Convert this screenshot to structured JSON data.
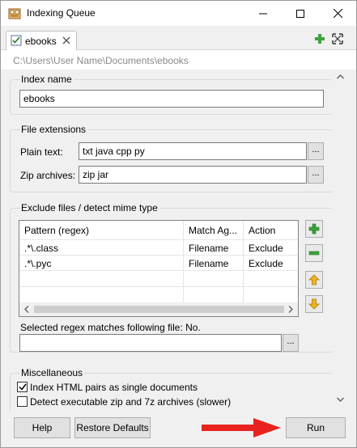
{
  "window": {
    "title": "Indexing Queue"
  },
  "tab": {
    "label": "ebooks"
  },
  "path": "C:\\Users\\User Name\\Documents\\ebooks",
  "index_name": {
    "label": "Index name",
    "value": "ebooks"
  },
  "file_extensions": {
    "label": "File extensions",
    "plain_text_label": "Plain text:",
    "plain_text_value": "txt java cpp py",
    "zip_label": "Zip archives:",
    "zip_value": "zip jar",
    "browse_label": "..."
  },
  "exclude": {
    "label": "Exclude files / detect mime type",
    "columns": [
      "Pattern (regex)",
      "Match Ag...",
      "Action"
    ],
    "rows": [
      [
        ".*\\.class",
        "Filename",
        "Exclude"
      ],
      [
        ".*\\.pyc",
        "Filename",
        "Exclude"
      ]
    ],
    "regex_match_label": "Selected regex matches following file: No.",
    "regex_match_value": "",
    "browse_label": "..."
  },
  "misc": {
    "label": "Miscellaneous",
    "html_pairs_label": "Index HTML pairs as single documents",
    "html_pairs_checked": true,
    "detect_zip_label": "Detect executable zip and 7z archives (slower)",
    "detect_zip_checked": false
  },
  "footer": {
    "help": "Help",
    "restore": "Restore Defaults",
    "run": "Run"
  },
  "colors": {
    "arrow": "#e8231f",
    "green_icon": "#3da33d",
    "yellow_icon": "#f0b41c"
  }
}
